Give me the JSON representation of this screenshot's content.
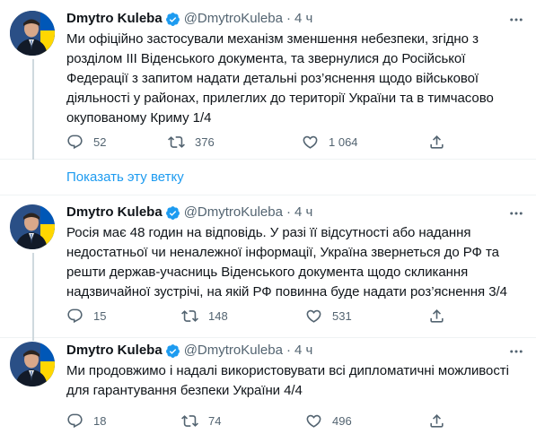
{
  "show_thread_label": "Показать эту ветку",
  "tweets": [
    {
      "name": "Dmytro Kuleba",
      "handle": "@DmytroKuleba",
      "dot": "·",
      "time": "4 ч",
      "lines": [
        "Ми офіційно застосували механізм зменшення небезпеки, згідно з",
        "розділом III Віденського документа, та звернулися до Російської",
        "Федерації з запитом надати детальні роз’яснення щодо військової",
        "діяльності у районах, прилеглих до території України та в тимчасово",
        "окупованому Криму 1/4"
      ],
      "replies": "52",
      "retweets": "376",
      "likes": "1 064"
    },
    {
      "name": "Dmytro Kuleba",
      "handle": "@DmytroKuleba",
      "dot": "·",
      "time": "4 ч",
      "lines": [
        "Росія має 48 годин на відповідь. У разі її відсутності або надання",
        "недостатньої чи неналежної інформації, Україна звернеться до РФ та",
        "решти держав-учасниць Віденського документа щодо скликання",
        "надзвичайної зустрічі, на якій РФ повинна буде надати роз’яснення 3/4"
      ],
      "replies": "15",
      "retweets": "148",
      "likes": "531"
    },
    {
      "name": "Dmytro Kuleba",
      "handle": "@DmytroKuleba",
      "dot": "·",
      "time": "4 ч",
      "lines": [
        "Ми продовжимо і надалі використовувати всі дипломатичні можливості",
        "для гарантування безпеки України 4/4"
      ],
      "replies": "18",
      "retweets": "74",
      "likes": "496"
    }
  ],
  "colors": {
    "accent": "#1d9bf0",
    "secondary_text": "#536471",
    "primary_text": "#0f1419",
    "divider": "#eff3f4",
    "flag_blue": "#0057b7",
    "flag_yellow": "#ffd700"
  },
  "icons": [
    "verified-badge-icon",
    "more-options-icon",
    "reply-icon",
    "retweet-icon",
    "like-icon",
    "share-icon"
  ]
}
